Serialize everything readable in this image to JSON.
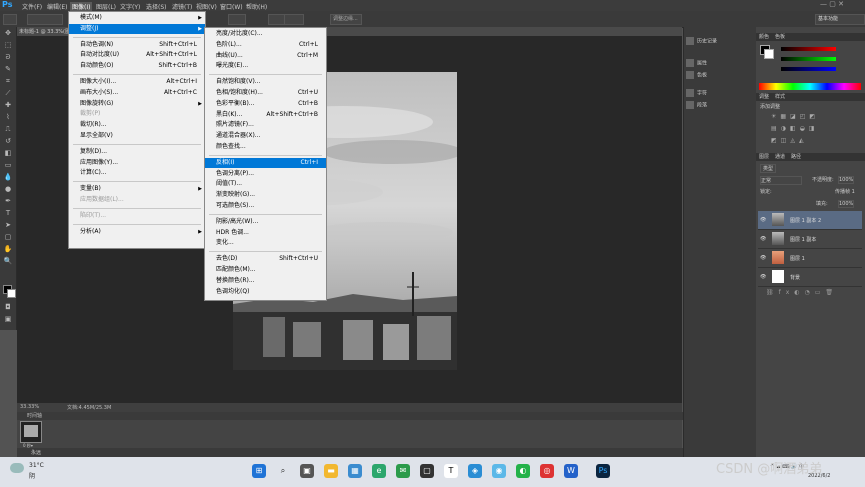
{
  "app_logo": "Ps",
  "menubar": [
    "文件(F)",
    "编辑(E)",
    "图像(I)",
    "图层(L)",
    "文字(Y)",
    "选择(S)",
    "滤镜(T)",
    "视图(V)",
    "窗口(W)",
    "帮助(H)"
  ],
  "optionsbar": {
    "workspace": "基本功能",
    "opt1": "调整边缘..."
  },
  "document_tab": "未标题-1 @ 33.3%(图层 1 副本 2, RGB/8)",
  "status": {
    "zoom": "33.33%",
    "doc": "文档:4.45M/25.3M"
  },
  "timeline": {
    "title": "时间轴",
    "frame_time": "0 秒▾",
    "loop": "永远"
  },
  "image_menu": {
    "items": [
      {
        "label": "模式(M)",
        "shortcut": "",
        "sub": true
      },
      {
        "label": "调整(J)",
        "shortcut": "",
        "sub": true,
        "highlight": true
      },
      {
        "label": "自动色调(N)",
        "shortcut": "Shift+Ctrl+L"
      },
      {
        "label": "自动对比度(U)",
        "shortcut": "Alt+Shift+Ctrl+L"
      },
      {
        "label": "自动颜色(O)",
        "shortcut": "Shift+Ctrl+B"
      },
      {
        "label": "图像大小(I)...",
        "shortcut": "Alt+Ctrl+I"
      },
      {
        "label": "画布大小(S)...",
        "shortcut": "Alt+Ctrl+C"
      },
      {
        "label": "图像旋转(G)",
        "shortcut": "",
        "sub": true
      },
      {
        "label": "裁剪(P)",
        "shortcut": "",
        "disabled": true
      },
      {
        "label": "裁切(R)...",
        "shortcut": ""
      },
      {
        "label": "显示全部(V)",
        "shortcut": ""
      },
      {
        "label": "复制(D)...",
        "shortcut": ""
      },
      {
        "label": "应用图像(Y)...",
        "shortcut": ""
      },
      {
        "label": "计算(C)...",
        "shortcut": ""
      },
      {
        "label": "变量(B)",
        "shortcut": "",
        "sub": true
      },
      {
        "label": "应用数据组(L)...",
        "shortcut": "",
        "disabled": true
      },
      {
        "label": "陷印(T)...",
        "shortcut": "",
        "disabled": true
      },
      {
        "label": "分析(A)",
        "shortcut": "",
        "sub": true
      }
    ]
  },
  "adjust_menu": {
    "items": [
      {
        "label": "亮度/对比度(C)...",
        "shortcut": ""
      },
      {
        "label": "色阶(L)...",
        "shortcut": "Ctrl+L"
      },
      {
        "label": "曲线(U)...",
        "shortcut": "Ctrl+M"
      },
      {
        "label": "曝光度(E)...",
        "shortcut": ""
      },
      {
        "label": "自然饱和度(V)...",
        "shortcut": ""
      },
      {
        "label": "色相/饱和度(H)...",
        "shortcut": "Ctrl+U"
      },
      {
        "label": "色彩平衡(B)...",
        "shortcut": "Ctrl+B"
      },
      {
        "label": "黑白(K)...",
        "shortcut": "Alt+Shift+Ctrl+B"
      },
      {
        "label": "照片滤镜(F)...",
        "shortcut": ""
      },
      {
        "label": "通道混合器(X)...",
        "shortcut": ""
      },
      {
        "label": "颜色查找...",
        "shortcut": ""
      },
      {
        "label": "反相(I)",
        "shortcut": "Ctrl+I",
        "highlight": true
      },
      {
        "label": "色调分离(P)...",
        "shortcut": ""
      },
      {
        "label": "阈值(T)...",
        "shortcut": ""
      },
      {
        "label": "渐变映射(G)...",
        "shortcut": ""
      },
      {
        "label": "可选颜色(S)...",
        "shortcut": ""
      },
      {
        "label": "阴影/高光(W)...",
        "shortcut": ""
      },
      {
        "label": "HDR 色调...",
        "shortcut": ""
      },
      {
        "label": "变化...",
        "shortcut": ""
      },
      {
        "label": "去色(D)",
        "shortcut": "Shift+Ctrl+U"
      },
      {
        "label": "匹配颜色(M)...",
        "shortcut": ""
      },
      {
        "label": "替换颜色(R)...",
        "shortcut": ""
      },
      {
        "label": "色调均化(Q)",
        "shortcut": ""
      }
    ]
  },
  "icon_panel": [
    "历史记录",
    "属性",
    "色板",
    "字符",
    "段落"
  ],
  "color_panel": {
    "tabs": [
      "颜色",
      "色板"
    ]
  },
  "adjust_panel": {
    "tabs": [
      "调整",
      "样式"
    ],
    "hint": "添加调整"
  },
  "layers_panel": {
    "tabs": [
      "图层",
      "通道",
      "路径"
    ],
    "kind": "类型",
    "blend": "正常",
    "opacity_label": "不透明度:",
    "opacity": "100%",
    "lock_label": "锁定:",
    "fill_label": "填充:",
    "fill": "100%",
    "propagate": "传播帧 1",
    "layers": [
      {
        "name": "图层 1 副本 2",
        "selected": true
      },
      {
        "name": "图层 1 副本",
        "selected": false
      },
      {
        "name": "图层 1",
        "selected": false
      },
      {
        "name": "背景",
        "selected": false
      }
    ]
  },
  "taskbar": {
    "temp": "31°C",
    "weather": "阴",
    "time": "2022/6/2",
    "watermark": "CSDN @啊酒弟弟"
  }
}
